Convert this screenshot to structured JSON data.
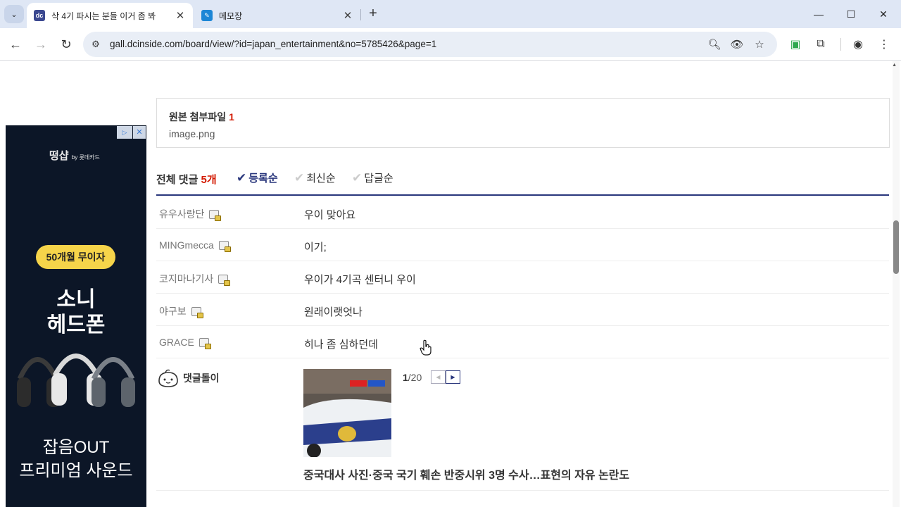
{
  "browser": {
    "tabs": [
      {
        "title": "삭 4기 파시는 분들 이거 좀 봐",
        "favicon": "dc-icon",
        "active": true
      },
      {
        "title": "메모장",
        "favicon": "memo-icon",
        "active": false
      }
    ],
    "url": "gall.dcinside.com/board/view/?id=japan_entertainment&no=5785426&page=1"
  },
  "ad": {
    "brand": "떵샵",
    "brand_sub": "by 롯데카드",
    "badge": "50개월 무이자",
    "headline_1": "소니",
    "headline_2": "헤드폰",
    "footer_1": "잡음OUT",
    "footer_2": "프리미엄 사운드"
  },
  "attachment": {
    "title": "원본 첨부파일",
    "count": "1",
    "file": "image.png"
  },
  "comments": {
    "total_label": "전체 댓글",
    "total_count": "5개",
    "sort_options": [
      "등록순",
      "최신순",
      "답글순"
    ],
    "active_sort": "등록순",
    "items": [
      {
        "nick": "유우사랑단",
        "text": "우이 맞아요"
      },
      {
        "nick": "MINGmecca",
        "text": "이기;"
      },
      {
        "nick": "코지마나기사",
        "text": "우이가 4기곡 센터니 우이"
      },
      {
        "nick": "야구보",
        "text": "원래이랫엇나"
      },
      {
        "nick": "GRACE",
        "text": "히나 좀 심하던데"
      }
    ]
  },
  "dory": {
    "label": "댓글돌이",
    "page_current": "1",
    "page_total": "/20",
    "title": "중국대사 사진·중국 국기 훼손 반중시위 3명 수사…표현의 자유 논란도"
  },
  "colors": {
    "accent": "#29367c",
    "count_red": "#d31900"
  }
}
